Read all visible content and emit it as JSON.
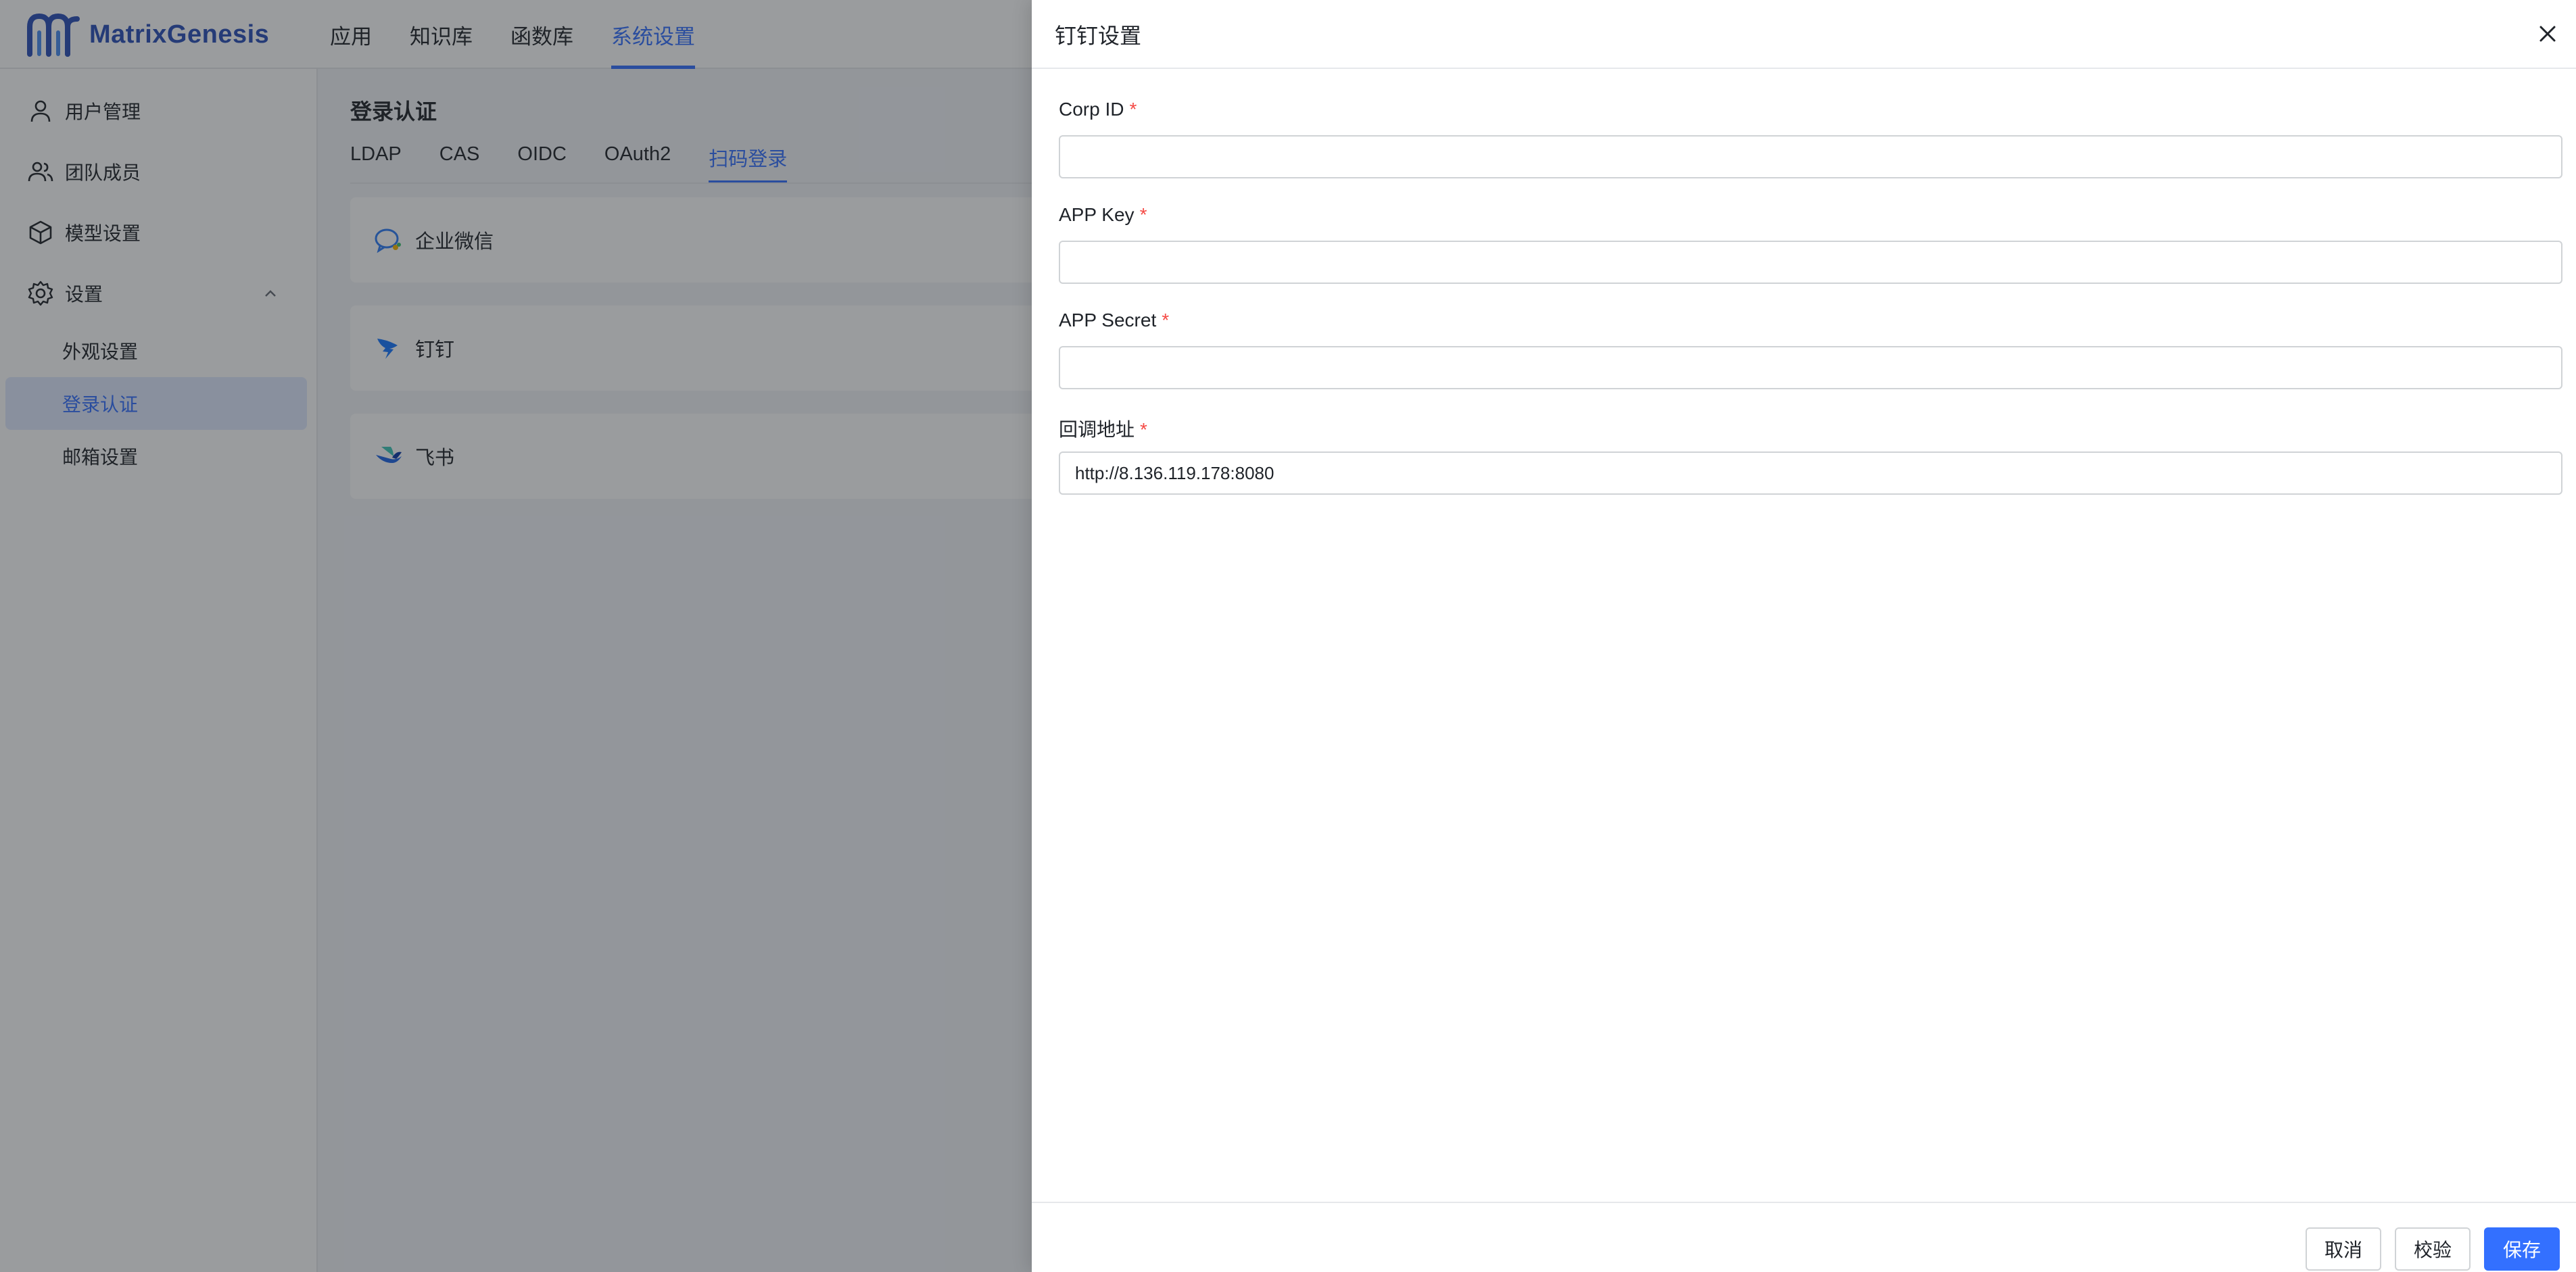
{
  "app": {
    "logo_text": "MatrixGenesis",
    "top_nav": [
      "应用",
      "知识库",
      "函数库",
      "系统设置"
    ],
    "active_top_nav": "系统设置"
  },
  "sidebar": {
    "items": [
      {
        "label": "用户管理",
        "icon": "user-icon"
      },
      {
        "label": "团队成员",
        "icon": "users-icon"
      },
      {
        "label": "模型设置",
        "icon": "cube-icon"
      },
      {
        "label": "设置",
        "icon": "gear-icon"
      }
    ],
    "sub_items": [
      "外观设置",
      "登录认证",
      "邮箱设置"
    ],
    "active_sub_item": "登录认证"
  },
  "main": {
    "title": "登录认证",
    "tabs": [
      "LDAP",
      "CAS",
      "OIDC",
      "OAuth2",
      "扫码登录"
    ],
    "active_tab": "扫码登录",
    "providers": [
      {
        "label": "企业微信",
        "icon": "wecom-icon"
      },
      {
        "label": "钉钉",
        "icon": "dingtalk-icon"
      },
      {
        "label": "飞书",
        "icon": "feishu-icon"
      }
    ]
  },
  "drawer": {
    "title": "钉钉设置",
    "fields": [
      {
        "label": "Corp ID",
        "required": "*",
        "value": ""
      },
      {
        "label": "APP Key",
        "required": "*",
        "value": ""
      },
      {
        "label": "APP Secret",
        "required": "*",
        "value": ""
      },
      {
        "label": "回调地址",
        "required": "*",
        "value": "http://8.136.119.178:8080"
      }
    ],
    "buttons": {
      "cancel": "取消",
      "verify": "校验",
      "save": "保存"
    }
  },
  "colors": {
    "accent": "#3370ff",
    "required": "#f54a45",
    "overlay": "rgba(31,35,41,0.45)"
  }
}
